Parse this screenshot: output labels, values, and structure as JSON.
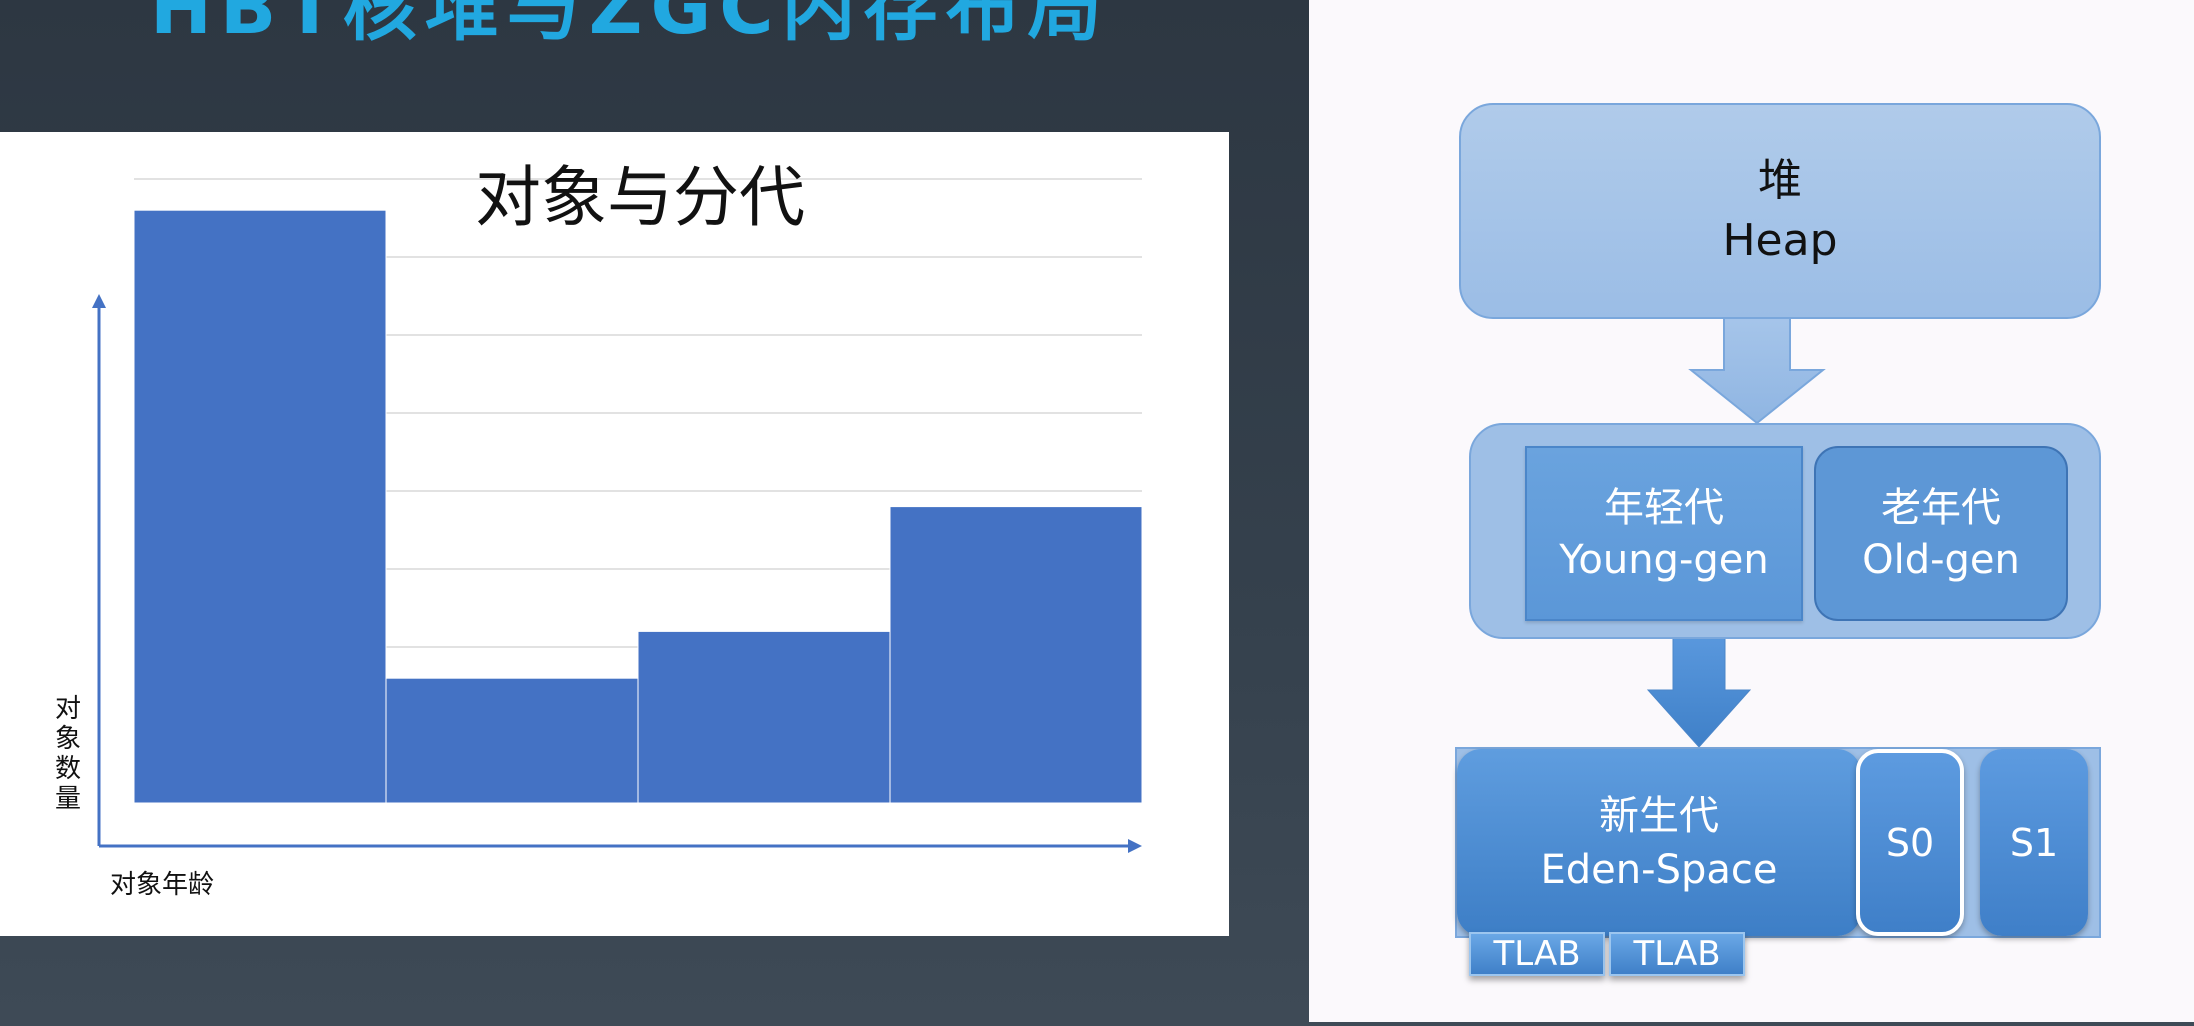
{
  "slide": {
    "title": "HBT核堆与ZGC内存布局"
  },
  "chart_data": {
    "type": "bar",
    "title": "对象与分代",
    "xlabel": "对象年龄",
    "ylabel": "对象数量",
    "categories": [
      "",
      "",
      "",
      ""
    ],
    "values": [
      7.6,
      1.6,
      2.2,
      3.8
    ],
    "ylim": [
      0,
      8
    ],
    "grid": true,
    "colors": {
      "bar": "#4472c4",
      "axis": "#4472c4",
      "grid": "#d9d9d9"
    }
  },
  "diagram": {
    "heap": {
      "line1": "堆",
      "line2": "Heap"
    },
    "young": {
      "line1": "年轻代",
      "line2": "Young-gen"
    },
    "old": {
      "line1": "老年代",
      "line2": "Old-gen"
    },
    "eden": {
      "line1": "新生代",
      "line2": "Eden-Space"
    },
    "s0": "S0",
    "s1": "S1",
    "tlab1": "TLAB",
    "tlab2": "TLAB",
    "colors": {
      "box_light": "#9ebfe6",
      "box_mid": "#5b97d8",
      "box_dark": "#3d7ec6"
    }
  }
}
